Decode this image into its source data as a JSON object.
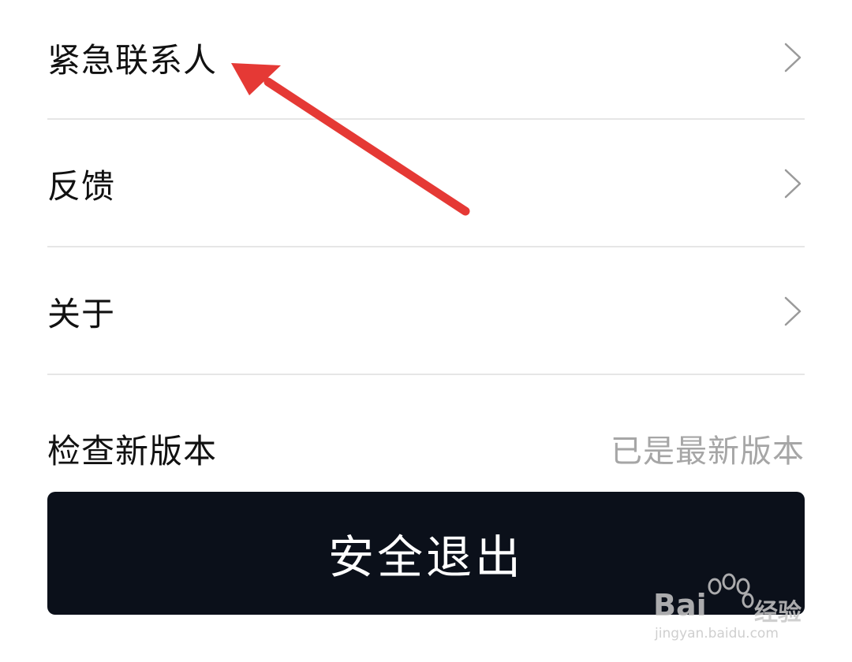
{
  "settings": {
    "items": [
      {
        "label": "紧急联系人",
        "icon": "chevron-right-icon"
      },
      {
        "label": "反馈",
        "icon": "chevron-right-icon"
      },
      {
        "label": "关于",
        "icon": "chevron-right-icon"
      }
    ],
    "version_check": {
      "label": "检查新版本",
      "status": "已是最新版本"
    }
  },
  "logout_button": {
    "label": "安全退出"
  },
  "watermark": {
    "brand": "Bai",
    "brand_suffix": "经验",
    "url": "jingyan.baidu.com"
  },
  "colors": {
    "background": "#ffffff",
    "text": "#111111",
    "muted": "#a6a6a6",
    "divider": "#e6e6e6",
    "logout_bg": "#0b101a",
    "annotation": "#e53935"
  }
}
